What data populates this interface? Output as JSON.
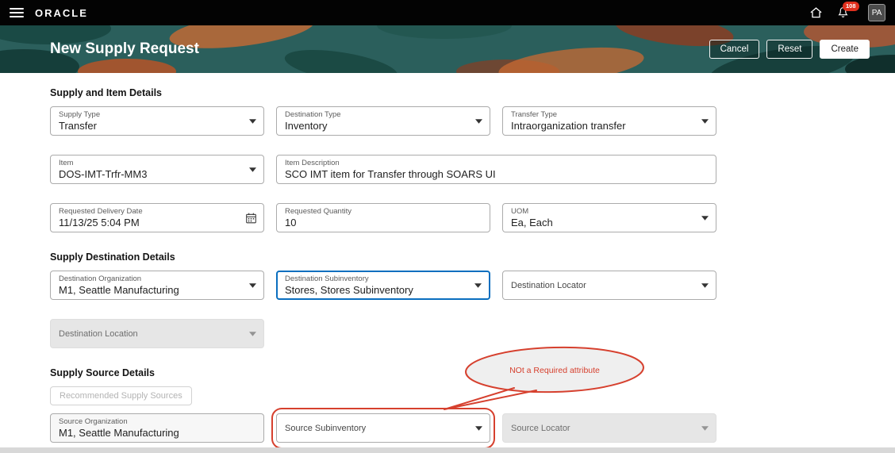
{
  "topbar": {
    "brand": "ORACLE",
    "notification_badge": "108",
    "avatar_initials": "PA"
  },
  "banner": {
    "title": "New Supply Request",
    "cancel_label": "Cancel",
    "reset_label": "Reset",
    "create_label": "Create"
  },
  "supply_item_details": {
    "heading": "Supply and Item Details",
    "supply_type": {
      "label": "Supply Type",
      "value": "Transfer"
    },
    "destination_type": {
      "label": "Destination Type",
      "value": "Inventory"
    },
    "transfer_type": {
      "label": "Transfer Type",
      "value": "Intraorganization transfer"
    },
    "item": {
      "label": "Item",
      "value": "DOS-IMT-Trfr-MM3"
    },
    "item_description": {
      "label": "Item Description",
      "value": "SCO IMT item for Transfer through SOARS UI"
    },
    "requested_delivery_date": {
      "label": "Requested Delivery Date",
      "value": "11/13/25 5:04 PM"
    },
    "requested_quantity": {
      "label": "Requested Quantity",
      "value": "10"
    },
    "uom": {
      "label": "UOM",
      "value": "Ea,  Each"
    }
  },
  "supply_destination_details": {
    "heading": "Supply Destination Details",
    "destination_organization": {
      "label": "Destination Organization",
      "value": "M1,  Seattle Manufacturing"
    },
    "destination_subinventory": {
      "label": "Destination Subinventory",
      "value": "Stores,  Stores Subinventory"
    },
    "destination_locator": {
      "label": "Destination Locator"
    },
    "destination_location": {
      "label": "Destination Location"
    }
  },
  "supply_source_details": {
    "heading": "Supply Source Details",
    "recommended_button_label": "Recommended Supply Sources",
    "source_organization": {
      "label": "Source Organization",
      "value": "M1, Seattle Manufacturing"
    },
    "source_subinventory": {
      "label": "Source Subinventory"
    },
    "source_locator": {
      "label": "Source Locator"
    }
  },
  "annotation": {
    "text": "NOt a Required attribute",
    "color": "#d6402e"
  },
  "colors": {
    "topbar_background": "#030303",
    "banner_background": "#2b5f5c",
    "focus_border": "#0b6fbf",
    "notification_red": "#e0301e",
    "annotation_red": "#d6402e"
  }
}
